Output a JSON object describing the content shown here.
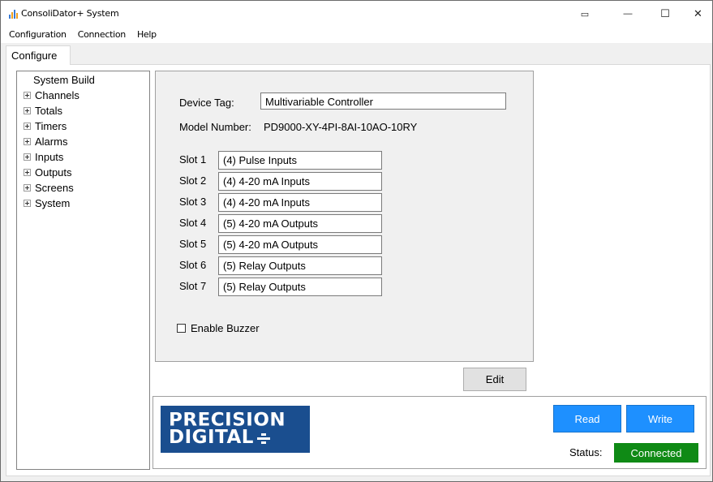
{
  "window": {
    "title": "ConsoliDator+ System",
    "controls": {
      "compact": "▭",
      "minimize": "—",
      "maximize": "☐",
      "close": "✕"
    }
  },
  "menu": {
    "items": [
      "Configuration",
      "Connection",
      "Help"
    ]
  },
  "tabs": [
    {
      "label": "Configure",
      "active": true
    }
  ],
  "tree": {
    "root": "System Build",
    "items": [
      "Channels",
      "Totals",
      "Timers",
      "Alarms",
      "Inputs",
      "Outputs",
      "Screens",
      "System"
    ]
  },
  "device": {
    "tag_label": "Device Tag:",
    "tag_value": "Multivariable Controller",
    "model_label": "Model Number:",
    "model_value": "PD9000-XY-4PI-8AI-10AO-10RY"
  },
  "slots": [
    {
      "label": "Slot 1",
      "value": "(4) Pulse Inputs"
    },
    {
      "label": "Slot 2",
      "value": "(4) 4-20 mA Inputs"
    },
    {
      "label": "Slot 3",
      "value": "(4) 4-20 mA Inputs"
    },
    {
      "label": "Slot 4",
      "value": "(5) 4-20 mA Outputs"
    },
    {
      "label": "Slot 5",
      "value": "(5) 4-20 mA Outputs"
    },
    {
      "label": "Slot 6",
      "value": "(5) Relay Outputs"
    },
    {
      "label": "Slot 7",
      "value": "(5) Relay Outputs"
    }
  ],
  "buzzer": {
    "label": "Enable Buzzer",
    "checked": false
  },
  "buttons": {
    "edit": "Edit",
    "read": "Read",
    "write": "Write"
  },
  "logo": {
    "line1": "PRECISION",
    "line2": "DIGITAL"
  },
  "status": {
    "label": "Status:",
    "value": "Connected"
  },
  "colors": {
    "button_blue": "#1e90ff",
    "status_green": "#0f8a15",
    "logo_blue": "#1a4e8f"
  }
}
